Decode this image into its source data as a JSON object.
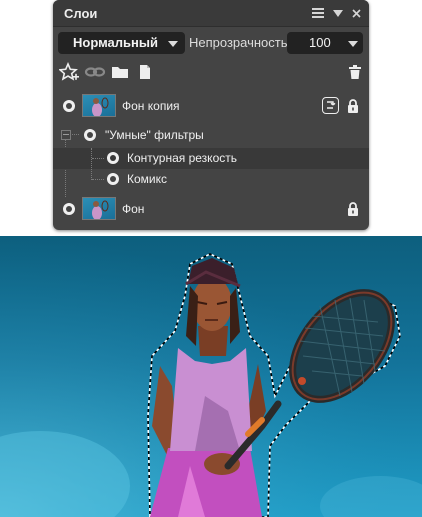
{
  "panel": {
    "title": "Слои",
    "blend_mode": "Нормальный",
    "opacity_label": "Непрозрачность",
    "opacity_value": "100",
    "layers": [
      {
        "name": "Фон копия"
      },
      {
        "smart_filters_label": "\"Умные\" фильтры"
      },
      {
        "name": "Контурная резкость"
      },
      {
        "name": "Комикс"
      },
      {
        "name": "Фон"
      }
    ]
  },
  "icons": {
    "menu": "hamburger-icon",
    "collapse": "triangle-down-icon",
    "close": "close-icon",
    "toolbar": [
      "star-add-icon",
      "link-mask-icon",
      "folder-icon",
      "new-layer-icon",
      "trash-icon"
    ],
    "layer": [
      "visibility-icon",
      "layer-thumbnail",
      "link-icon",
      "lock-icon"
    ]
  },
  "colors": {
    "panel_bg": "#444444",
    "titlebar_bg": "#3a3a3a",
    "field_bg": "#222222",
    "selected_row_bg": "#393939",
    "text": "#f0f0f0",
    "sky_top": "#0d5f7e",
    "sky_bottom": "#1f9cc6"
  }
}
